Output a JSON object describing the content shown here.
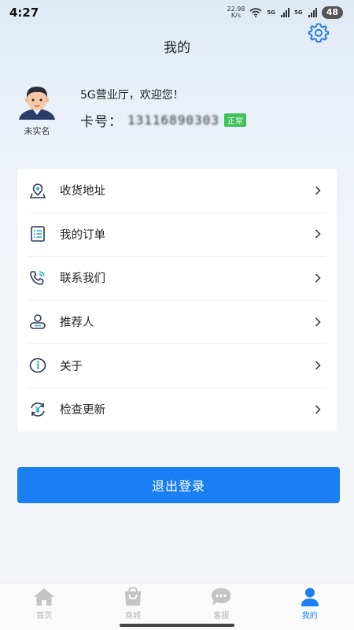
{
  "status_bar": {
    "time": "4:27",
    "speed_value": "22.98",
    "speed_unit": "K/s",
    "sim1_tag": "5G",
    "sim2_tag": "5G",
    "battery": "48"
  },
  "header": {
    "title": "我的",
    "settings_icon": "gear-icon"
  },
  "profile": {
    "avatar_caption": "未实名",
    "welcome": "5G营业厅，欢迎您！",
    "card_label": "卡号：",
    "card_number": "13116890303",
    "status_badge": "正常"
  },
  "menu": [
    {
      "label": "收货地址",
      "icon": "location-pin-icon"
    },
    {
      "label": "我的订单",
      "icon": "order-list-icon"
    },
    {
      "label": "联系我们",
      "icon": "phone-call-icon"
    },
    {
      "label": "推荐人",
      "icon": "referrer-icon"
    },
    {
      "label": "关于",
      "icon": "info-icon"
    },
    {
      "label": "检查更新",
      "icon": "refresh-update-icon"
    }
  ],
  "logout_button": "退出登录",
  "tabbar": [
    {
      "label": "首页",
      "icon": "home-icon",
      "active": false
    },
    {
      "label": "商城",
      "icon": "shopping-bag-icon",
      "active": false
    },
    {
      "label": "客服",
      "icon": "chat-bubble-icon",
      "active": false
    },
    {
      "label": "我的",
      "icon": "user-icon",
      "active": true
    }
  ],
  "colors": {
    "accent": "#1a7ff2",
    "badge_green": "#3cc15a",
    "inactive_tab": "#b3b3b3"
  }
}
